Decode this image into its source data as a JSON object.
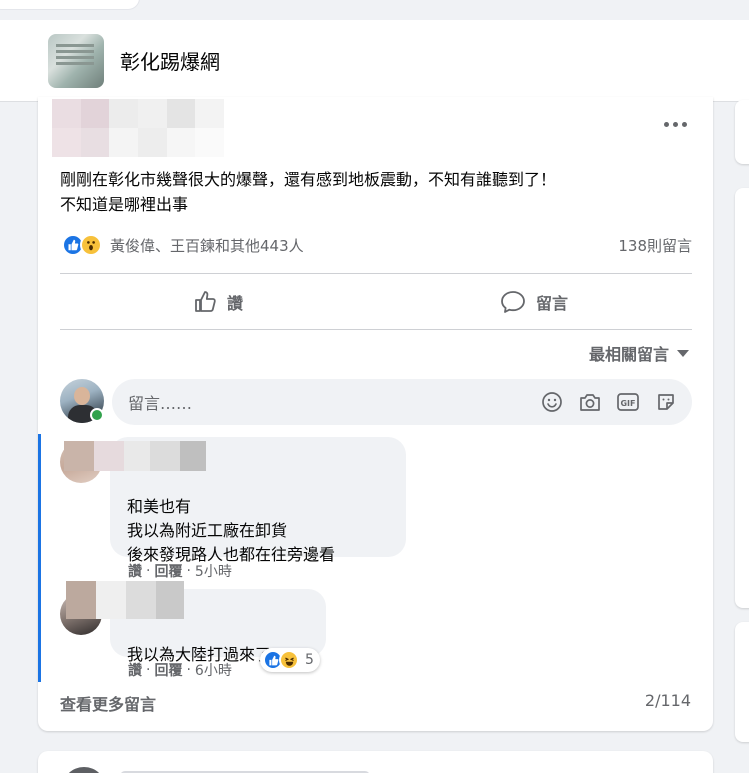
{
  "group": {
    "name": "彰化踢爆網"
  },
  "post": {
    "text": "剛剛在彰化市幾聲很大的爆聲，還有感到地板震動，不知有誰聽到了！\n不知道是哪裡出事",
    "reactions": {
      "icons": [
        "like",
        "wow"
      ],
      "names": "黃俊偉、王百鍊和其他443人",
      "comment_count": "138則留言"
    },
    "actions": {
      "like_label": "讚",
      "comment_label": "留言"
    },
    "sort_label": "最相關留言",
    "composer": {
      "placeholder": "留言……",
      "tools": [
        "emoji-icon",
        "camera-icon",
        "gif-icon",
        "sticker-icon"
      ]
    }
  },
  "comments": [
    {
      "text": "和美也有\n我以為附近工廠在卸貨\n後來發現路人也都在往旁邊看",
      "like_label": "讚",
      "reply_label": "回覆",
      "time": "5小時"
    },
    {
      "text": "我以為大陸打過來了",
      "like_label": "讚",
      "reply_label": "回覆",
      "time": "6小時",
      "reaction_icons": [
        "like",
        "haha"
      ],
      "reaction_count": "5"
    }
  ],
  "footer": {
    "view_more": "查看更多留言",
    "page_count": "2/114"
  },
  "colors": {
    "accent": "#1b74e4",
    "secondary_text": "#65676b",
    "bubble": "#f0f2f5",
    "online": "#31a24c"
  }
}
